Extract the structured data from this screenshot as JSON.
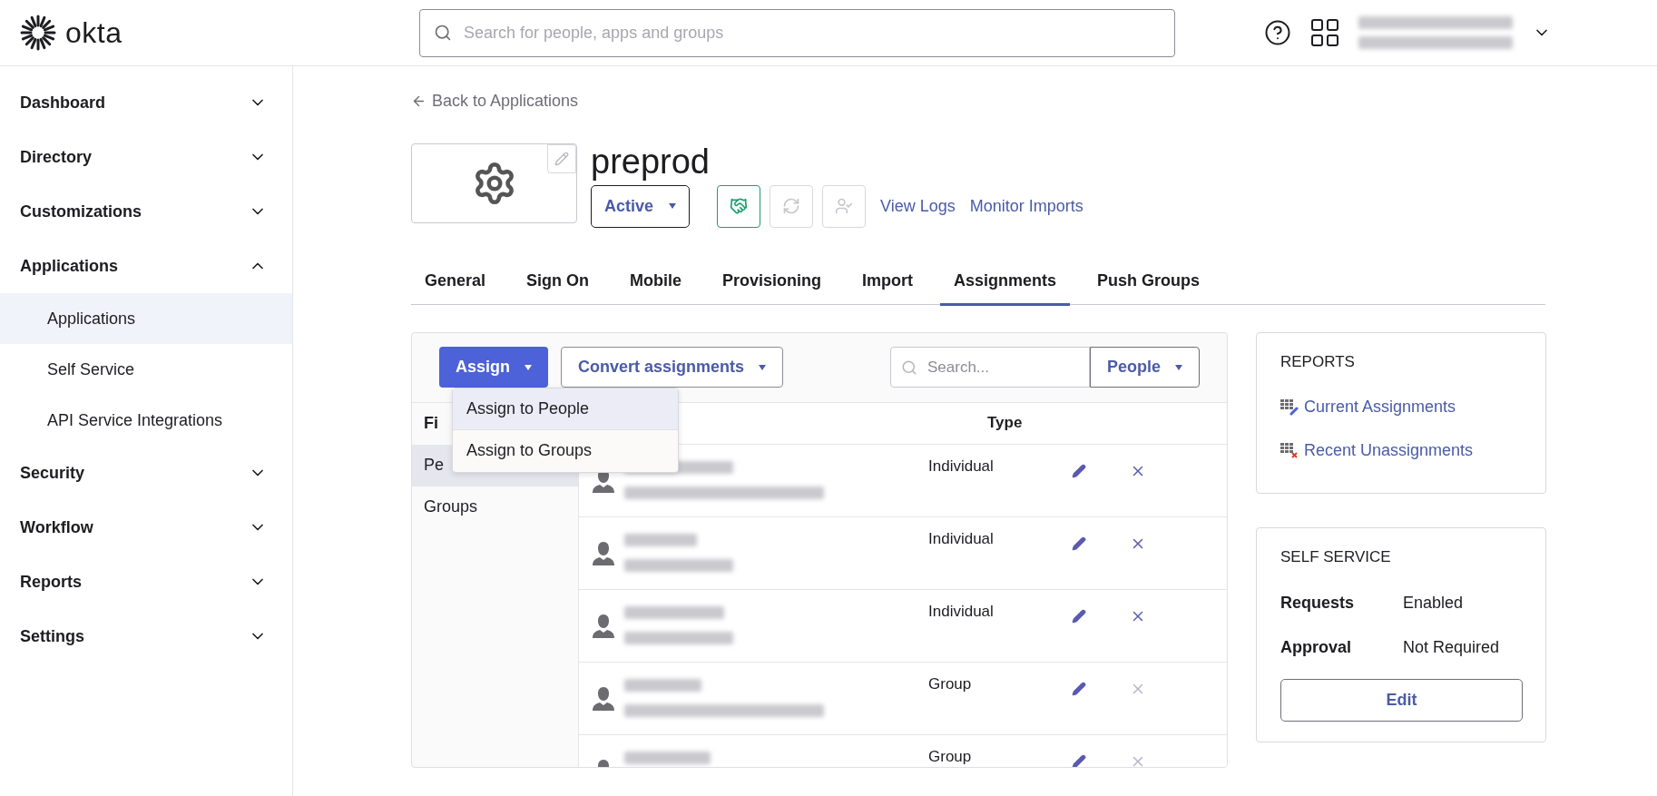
{
  "header": {
    "logo": "okta",
    "search": {
      "placeholder": "Search for people, apps and groups"
    }
  },
  "sidebar": {
    "items": [
      {
        "label": "Dashboard",
        "expanded": false
      },
      {
        "label": "Directory",
        "expanded": false
      },
      {
        "label": "Customizations",
        "expanded": false
      },
      {
        "label": "Applications",
        "expanded": true,
        "children": [
          {
            "label": "Applications",
            "selected": true
          },
          {
            "label": "Self Service",
            "selected": false
          },
          {
            "label": "API Service Integrations",
            "selected": false
          }
        ]
      },
      {
        "label": "Security",
        "expanded": false
      },
      {
        "label": "Workflow",
        "expanded": false
      },
      {
        "label": "Reports",
        "expanded": false
      },
      {
        "label": "Settings",
        "expanded": false
      }
    ]
  },
  "back_link": "Back to Applications",
  "app": {
    "name": "preprod",
    "status": "Active",
    "links": [
      "View Logs",
      "Monitor Imports"
    ]
  },
  "tabs": [
    {
      "label": "General",
      "selected": false
    },
    {
      "label": "Sign On",
      "selected": false
    },
    {
      "label": "Mobile",
      "selected": false
    },
    {
      "label": "Provisioning",
      "selected": false
    },
    {
      "label": "Import",
      "selected": false
    },
    {
      "label": "Assignments",
      "selected": true
    },
    {
      "label": "Push Groups",
      "selected": false
    }
  ],
  "toolbar": {
    "assign": "Assign",
    "convert": "Convert assignments",
    "search": {
      "placeholder": "Search..."
    },
    "filter_type": "People"
  },
  "assign_menu": [
    {
      "label": "Assign to People",
      "selected": true
    },
    {
      "label": "Assign to Groups",
      "selected": false
    }
  ],
  "filters": {
    "heading": "Fi",
    "items": [
      {
        "label": "Pe",
        "selected": true
      },
      {
        "label": "Groups",
        "selected": false
      }
    ]
  },
  "table": {
    "columns": [
      "Type"
    ],
    "rows": [
      {
        "type": "Individual",
        "removable": true
      },
      {
        "type": "Individual",
        "removable": true
      },
      {
        "type": "Individual",
        "removable": true
      },
      {
        "type": "Group",
        "removable": false
      },
      {
        "type": "Group",
        "removable": false
      }
    ]
  },
  "reports": {
    "title": "REPORTS",
    "links": [
      {
        "label": "Current Assignments",
        "kind": "current"
      },
      {
        "label": "Recent Unassignments",
        "kind": "recent"
      }
    ]
  },
  "self_service": {
    "title": "SELF SERVICE",
    "fields": [
      {
        "label": "Requests",
        "value": "Enabled"
      },
      {
        "label": "Approval",
        "value": "Not Required"
      }
    ],
    "button": "Edit"
  }
}
